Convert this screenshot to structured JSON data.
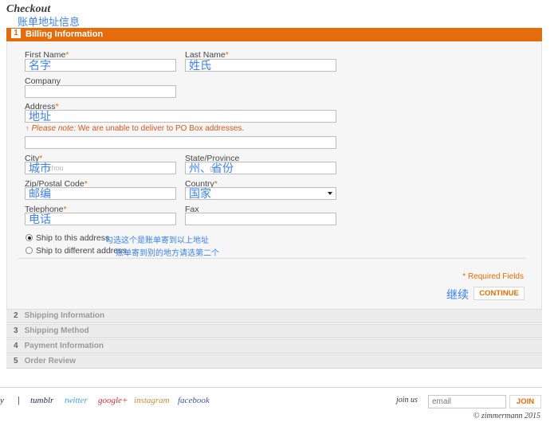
{
  "page": {
    "title": "Checkout",
    "title_annotation": "账单地址信息"
  },
  "active_step": {
    "number": "1",
    "label": "Billing Information"
  },
  "form": {
    "first_name": {
      "label": "First Name",
      "req": "*",
      "annotation": "名字"
    },
    "last_name": {
      "label": "Last Name",
      "req": "*",
      "annotation": "姓氏",
      "ghost": "g"
    },
    "company": {
      "label": "Company"
    },
    "address": {
      "label": "Address",
      "req": "*",
      "annotation": "地址"
    },
    "note": {
      "arrow": "↑",
      "em": "Please note:",
      "text": "We are unable to deliver to PO Box addresses."
    },
    "city": {
      "label": "City",
      "req": "*",
      "annotation": "城市",
      "ghost": "zhou"
    },
    "state": {
      "label": "State/Province",
      "annotation": "州、省份",
      "ghost": "g"
    },
    "zip": {
      "label": "Zip/Postal Code",
      "req": "*",
      "annotation": "邮编"
    },
    "country": {
      "label": "Country",
      "req": "*",
      "annotation": "国家"
    },
    "telephone": {
      "label": "Telephone",
      "req": "*",
      "annotation": "电话"
    },
    "fax": {
      "label": "Fax"
    },
    "ship_same": {
      "label": "Ship to this address",
      "annotation": "勾选这个是账单寄到以上地址",
      "checked": true
    },
    "ship_diff": {
      "label": "Ship to different address",
      "annotation": "账单寄到别的地方请选第二个",
      "checked": false
    },
    "required_fields": "* Required Fields",
    "continue_annotation": "继续",
    "continue_label": "CONTINUE"
  },
  "steps": [
    {
      "number": "2",
      "label": "Shipping Information"
    },
    {
      "number": "3",
      "label": "Shipping Method"
    },
    {
      "number": "4",
      "label": "Payment Information"
    },
    {
      "number": "5",
      "label": "Order Review"
    }
  ],
  "footer": {
    "cut_text": "y",
    "separator": "|",
    "social": [
      {
        "name": "tumblr",
        "color": "#1c2a57"
      },
      {
        "name": "twitter",
        "color": "#4aa3df"
      },
      {
        "name": "google+",
        "color": "#c7302f"
      },
      {
        "name": "instagram",
        "color": "#c98a37"
      },
      {
        "name": "facebook",
        "color": "#3b5998"
      }
    ],
    "join_label": "join us",
    "email_placeholder": "email",
    "join_button": "JOIN",
    "copyright": "© zimmermann 2015"
  },
  "colors": {
    "accent": "#e46c0a",
    "annotation": "#3d82e6"
  }
}
